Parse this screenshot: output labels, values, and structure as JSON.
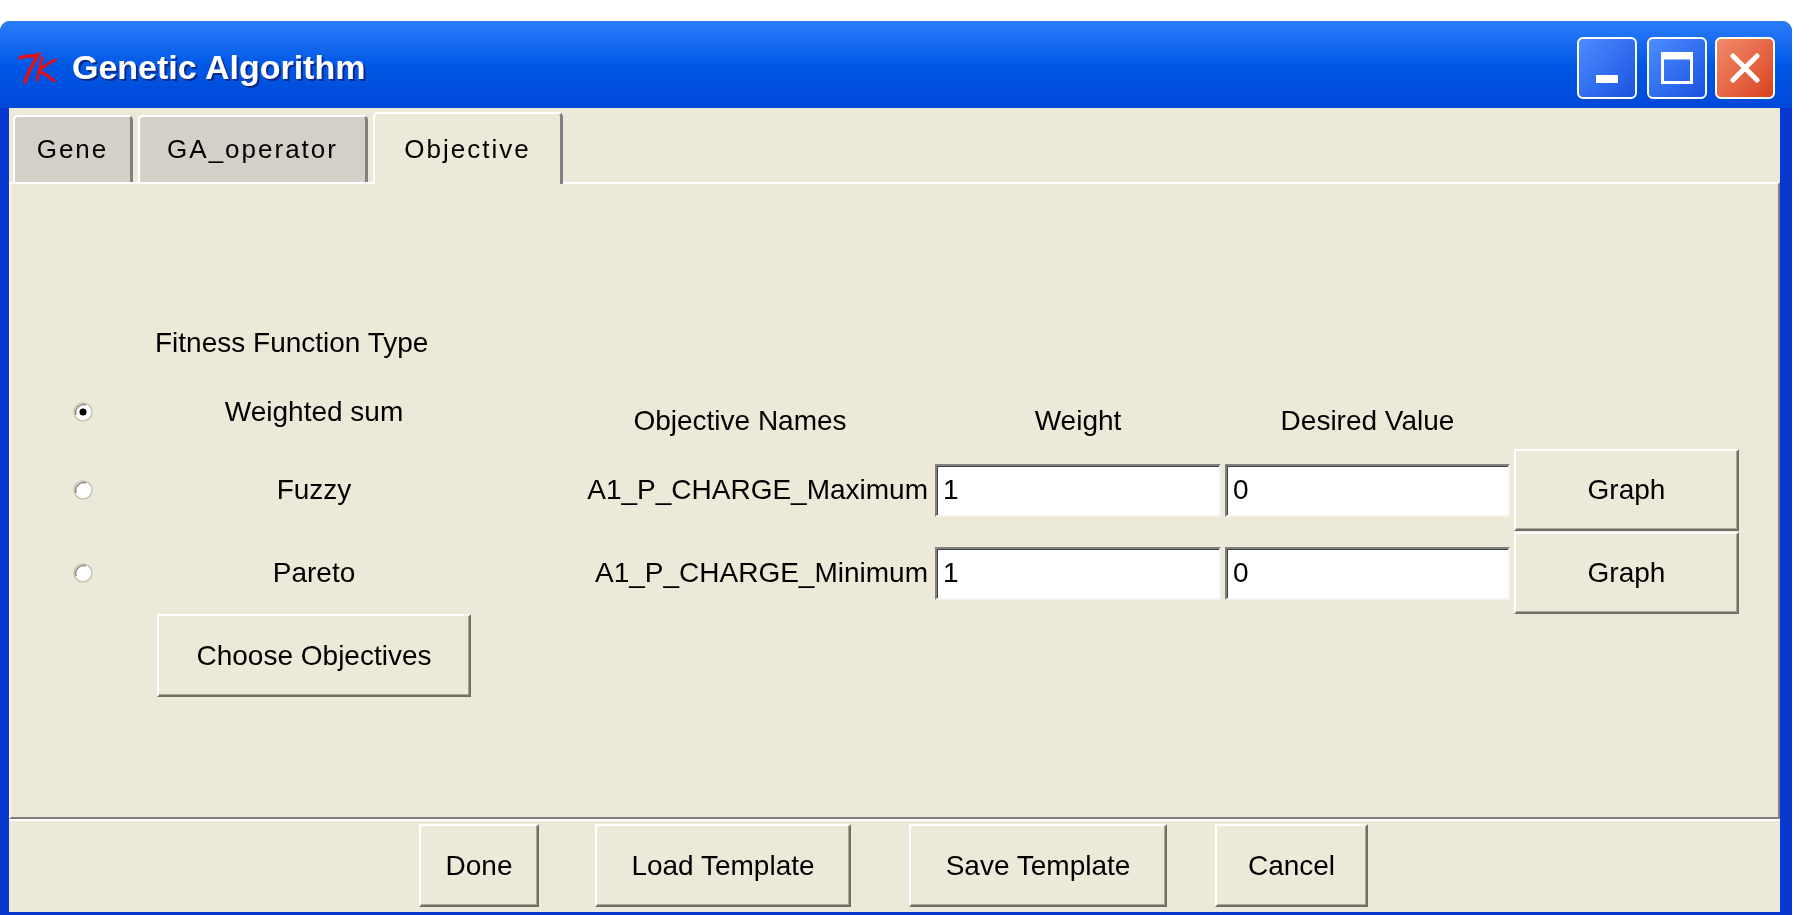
{
  "window": {
    "title": "Genetic Algorithm"
  },
  "tabs": [
    {
      "label": "Gene",
      "selected": false
    },
    {
      "label": "GA_operator",
      "selected": false
    },
    {
      "label": "Objective",
      "selected": true
    }
  ],
  "fitness_function": {
    "heading": "Fitness Function Type",
    "options": [
      {
        "label": "Weighted sum",
        "selected": true
      },
      {
        "label": "Fuzzy",
        "selected": false
      },
      {
        "label": "Pareto",
        "selected": false
      }
    ],
    "button": "Choose Objectives"
  },
  "objectives": {
    "columns": [
      "Objective Names",
      "Weight",
      "Desired Value"
    ],
    "rows": [
      {
        "name": "A1_P_CHARGE_Maximum",
        "weight": "1",
        "desired_value": "0",
        "button": "Graph"
      },
      {
        "name": "A1_P_CHARGE_Minimum",
        "weight": "1",
        "desired_value": "0",
        "button": "Graph"
      }
    ]
  },
  "footer_buttons": [
    "Done",
    "Load Template",
    "Save Template",
    "Cancel"
  ]
}
